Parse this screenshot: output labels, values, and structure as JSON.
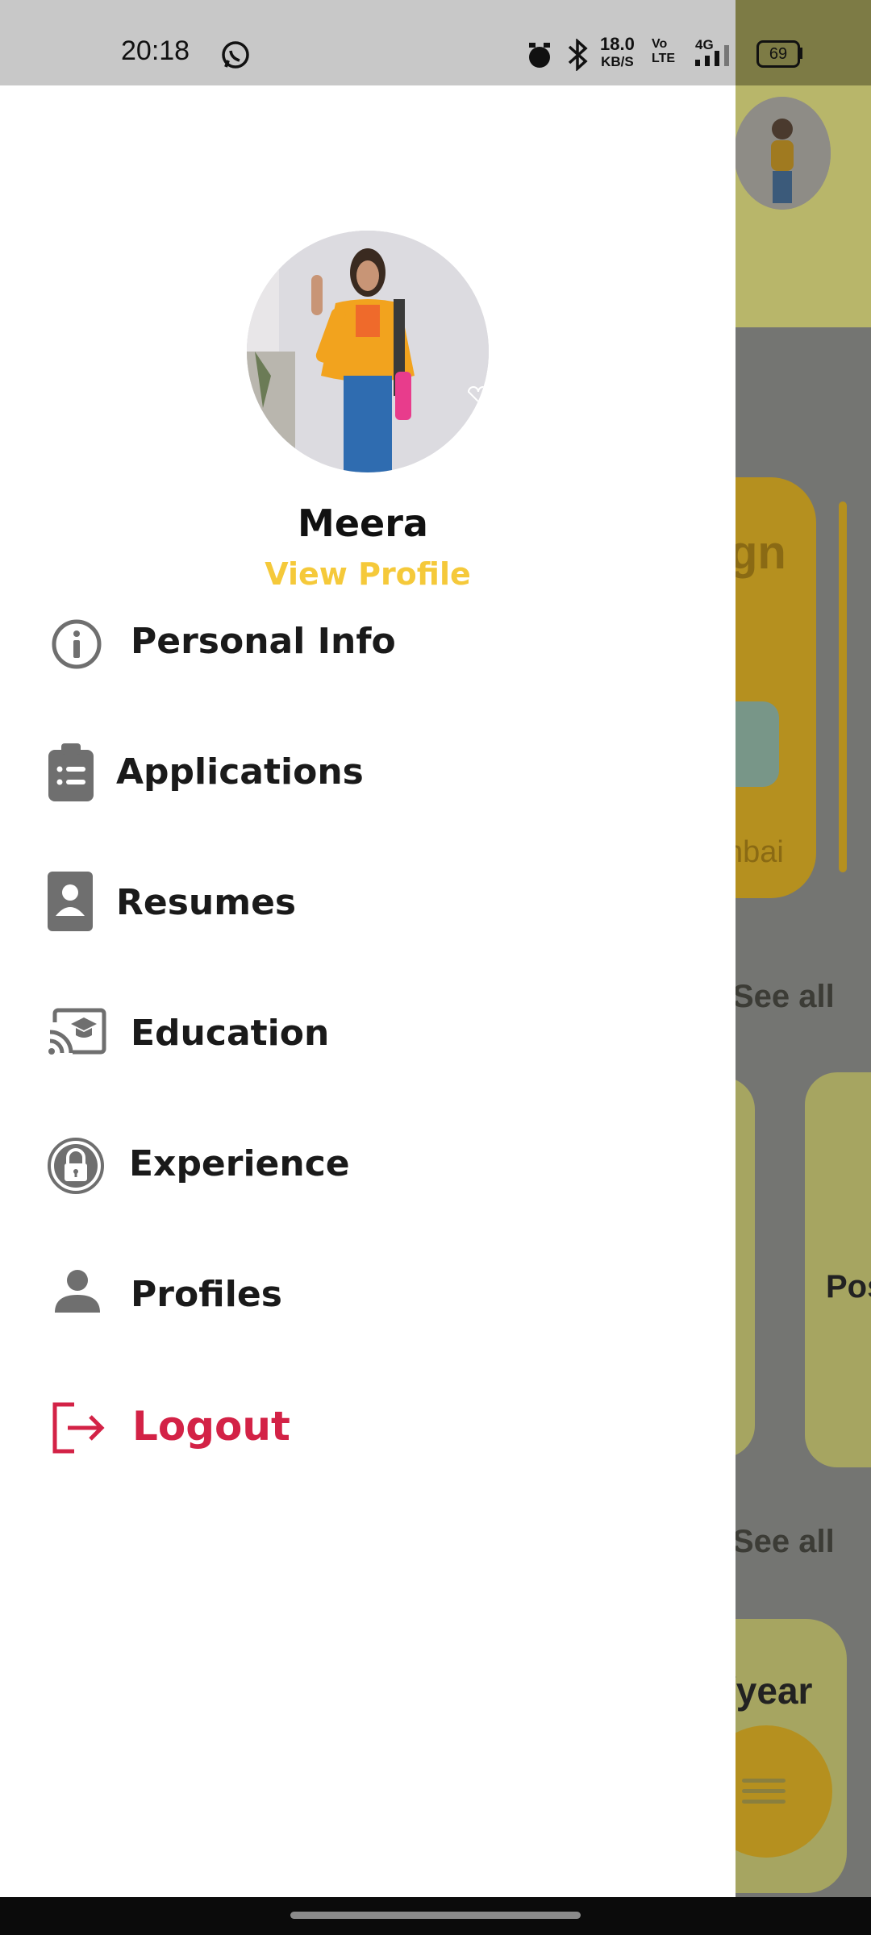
{
  "status_bar": {
    "time": "20:18",
    "net_speed_value": "18.0",
    "net_speed_unit": "KB/S",
    "volte_top": "Vo",
    "volte_bottom": "LTE",
    "network": "4G",
    "battery": "69"
  },
  "drawer": {
    "user_name": "Meera",
    "view_profile_label": "View Profile",
    "menu": {
      "personal_info": "Personal Info",
      "applications": "Applications",
      "resumes": "Resumes",
      "education": "Education",
      "experience": "Experience",
      "profiles": "Profiles",
      "logout": "Logout"
    }
  },
  "background_screen": {
    "card_text_top": "gn",
    "card_text_city": "nbai",
    "see_all_1": "See all",
    "card_text_pos": "Pos",
    "see_all_2": "See all",
    "salary_fragment": "/year"
  },
  "colors": {
    "accent_yellow": "#f5c93a",
    "logout_red": "#d32246",
    "icon_gray": "#6f6f6f"
  }
}
